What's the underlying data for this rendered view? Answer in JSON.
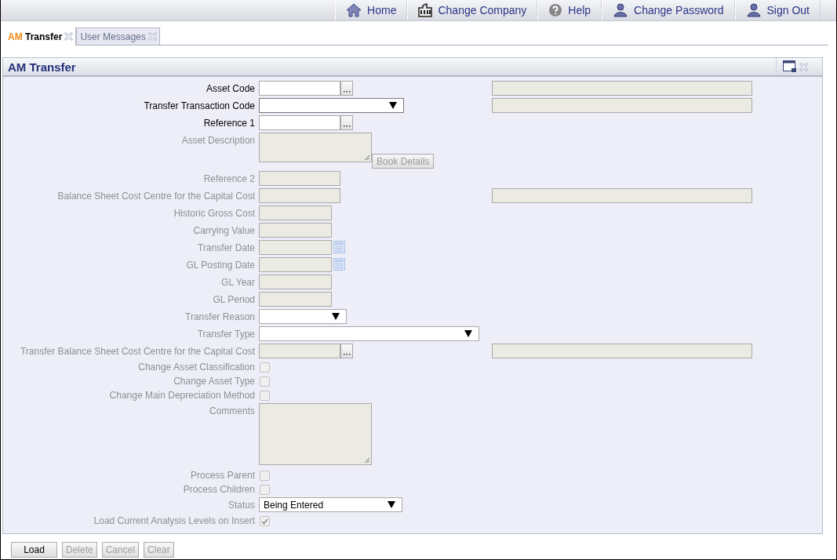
{
  "top_nav": [
    {
      "label": "Home"
    },
    {
      "label": "Change Company"
    },
    {
      "label": "Help"
    },
    {
      "label": "Change Password"
    },
    {
      "label": "Sign Out"
    }
  ],
  "tabs": [
    {
      "module": "AM",
      "label": "Transfer",
      "selected": true
    },
    {
      "label": "User Messages",
      "selected": false
    }
  ],
  "panel": {
    "title": "AM Transfer"
  },
  "fields": [
    {
      "label": "Asset Code",
      "kind": "lookup",
      "disabled": false,
      "side_field": true
    },
    {
      "label": "Transfer Transaction Code",
      "kind": "select",
      "disabled": false,
      "side_field": true
    },
    {
      "label": "Reference 1",
      "kind": "lookup",
      "disabled": false,
      "side_field": false
    },
    {
      "label": "Asset Description",
      "kind": "textarea",
      "disabled": true,
      "side_field": false,
      "button": {
        "label": "Book Details",
        "disabled": true
      }
    },
    {
      "label": "Reference 2",
      "kind": "input",
      "disabled": true,
      "side_field": false
    },
    {
      "label": "Balance Sheet Cost Centre for the Capital Cost",
      "kind": "input",
      "disabled": true,
      "side_field": true
    },
    {
      "label": "Historic Gross Cost",
      "kind": "input",
      "disabled": true,
      "side_field": false
    },
    {
      "label": "Carrying Value",
      "kind": "input",
      "disabled": true,
      "side_field": false
    },
    {
      "label": "Transfer Date",
      "kind": "date",
      "disabled": true,
      "side_field": false
    },
    {
      "label": "GL Posting Date",
      "kind": "date",
      "disabled": true,
      "side_field": false
    },
    {
      "label": "GL Year",
      "kind": "input",
      "disabled": true,
      "side_field": false
    },
    {
      "label": "GL Period",
      "kind": "input",
      "disabled": true,
      "side_field": false
    },
    {
      "label": "Transfer Reason",
      "kind": "select",
      "disabled": true,
      "side_field": false
    },
    {
      "label": "Transfer Type",
      "kind": "select",
      "disabled": true,
      "side_field": false
    },
    {
      "label": "Transfer Balance Sheet Cost Centre for the Capital Cost",
      "kind": "lookup",
      "disabled": true,
      "side_field": true
    },
    {
      "label": "Change Asset Classification",
      "kind": "checkbox",
      "disabled": true,
      "checked": false,
      "side_field": false
    },
    {
      "label": "Change Asset Type",
      "kind": "checkbox",
      "disabled": true,
      "checked": false,
      "side_field": false
    },
    {
      "label": "Change Main Depreciation Method",
      "kind": "checkbox",
      "disabled": true,
      "checked": false,
      "side_field": false
    },
    {
      "label": "Comments",
      "kind": "textarea",
      "disabled": true,
      "side_field": false
    },
    {
      "label": "Process Parent",
      "kind": "checkbox",
      "disabled": true,
      "checked": false,
      "side_field": false
    },
    {
      "label": "Process Children",
      "kind": "checkbox",
      "disabled": true,
      "checked": false,
      "side_field": false
    },
    {
      "label": "Status",
      "kind": "select",
      "disabled": true,
      "value": "Being Entered",
      "side_field": false
    },
    {
      "label": "Load Current Analysis Levels on Insert",
      "kind": "checkbox",
      "disabled": true,
      "checked": true,
      "side_field": false
    }
  ],
  "buttons": [
    {
      "label": "Load",
      "disabled": false
    },
    {
      "label": "Delete",
      "disabled": true
    },
    {
      "label": "Cancel",
      "disabled": true
    },
    {
      "label": "Clear",
      "disabled": true
    }
  ]
}
